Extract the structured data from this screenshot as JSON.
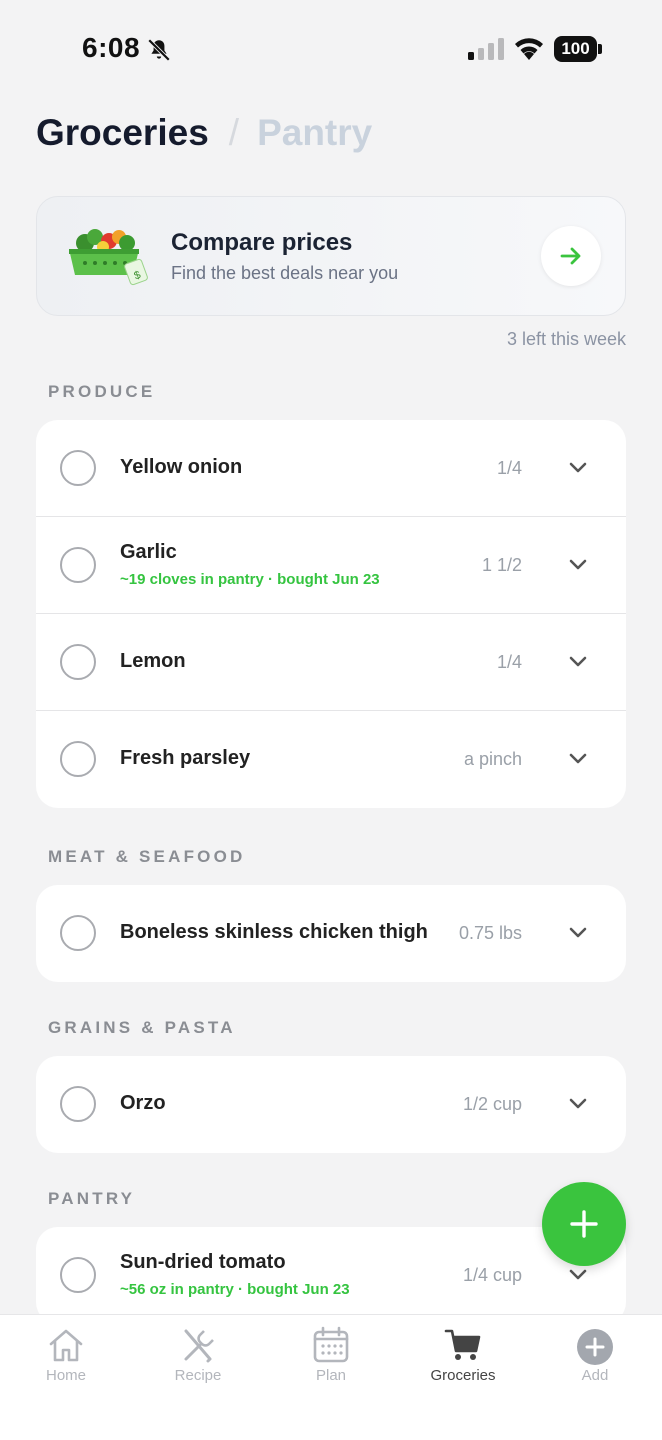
{
  "status_bar": {
    "time": "6:08",
    "battery": "100"
  },
  "header": {
    "active_tab": "Groceries",
    "separator": "/",
    "inactive_tab": "Pantry"
  },
  "promo": {
    "title": "Compare prices",
    "subtitle": "Find the best deals near you",
    "remaining_note": "3 left this week"
  },
  "sections": {
    "produce": {
      "label": "PRODUCE",
      "items": [
        {
          "name": "Yellow onion",
          "qty": "1/4"
        },
        {
          "name": "Garlic",
          "qty": "1 1/2",
          "note": "~19 cloves in pantry · bought Jun 23"
        },
        {
          "name": "Lemon",
          "qty": "1/4"
        },
        {
          "name": "Fresh parsley",
          "qty": "a pinch"
        }
      ]
    },
    "meat": {
      "label": "MEAT & SEAFOOD",
      "items": [
        {
          "name": "Boneless skinless chicken thigh",
          "qty": "0.75 lbs"
        }
      ]
    },
    "grains": {
      "label": "GRAINS & PASTA",
      "items": [
        {
          "name": "Orzo",
          "qty": "1/2 cup"
        }
      ]
    },
    "pantry": {
      "label": "PANTRY",
      "items": [
        {
          "name": "Sun-dried tomato",
          "qty": "1/4 cup",
          "note": "~56 oz in pantry · bought Jun 23"
        }
      ]
    }
  },
  "tabbar": {
    "home": "Home",
    "recipe": "Recipe",
    "plan": "Plan",
    "groceries": "Groceries",
    "add": "Add"
  },
  "colors": {
    "accent_green": "#3ac43e",
    "note_green": "#35c440"
  }
}
